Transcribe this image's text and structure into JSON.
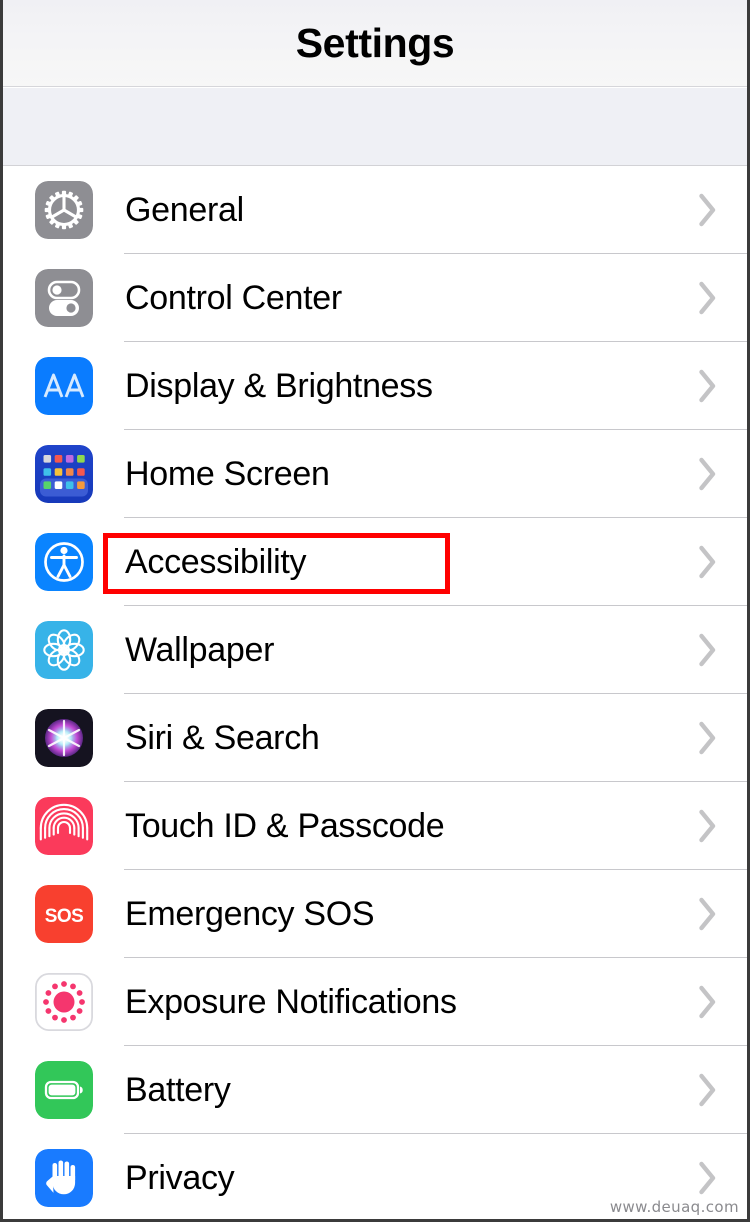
{
  "header": {
    "title": "Settings"
  },
  "watermark": "www.deuaq.com",
  "colors": {
    "accent_blue": "#0a84ff",
    "gray_icon": "#8e8e93",
    "highlight_red": "#ff0000",
    "chevron": "#c4c4c6",
    "separator": "#c8c8cc",
    "row_background": "#ffffff",
    "band_background": "#eff0f5"
  },
  "list": {
    "items": [
      {
        "label": "General",
        "icon": "gear-icon",
        "icon_color": "#8e8e93",
        "chevron": "chevron-right-icon",
        "highlighted": false
      },
      {
        "label": "Control Center",
        "icon": "toggles-icon",
        "icon_color": "#8e8e93",
        "chevron": "chevron-right-icon",
        "highlighted": false
      },
      {
        "label": "Display & Brightness",
        "icon": "display-brightness-aa-icon",
        "icon_color": "#0a7cff",
        "chevron": "chevron-right-icon",
        "highlighted": false
      },
      {
        "label": "Home Screen",
        "icon": "home-screen-grid-icon",
        "icon_color": "#1a3fc4",
        "chevron": "chevron-right-icon",
        "highlighted": false
      },
      {
        "label": "Accessibility",
        "icon": "accessibility-person-icon",
        "icon_color": "#0a84ff",
        "chevron": "chevron-right-icon",
        "highlighted": true
      },
      {
        "label": "Wallpaper",
        "icon": "wallpaper-flower-icon",
        "icon_color": "#37b3e8",
        "chevron": "chevron-right-icon",
        "highlighted": false
      },
      {
        "label": "Siri & Search",
        "icon": "siri-orb-icon",
        "icon_color": "#151320",
        "chevron": "chevron-right-icon",
        "highlighted": false
      },
      {
        "label": "Touch ID & Passcode",
        "icon": "fingerprint-icon",
        "icon_color": "#fb3a5b",
        "chevron": "chevron-right-icon",
        "highlighted": false
      },
      {
        "label": "Emergency SOS",
        "icon": "sos-icon",
        "icon_color": "#f8402f",
        "chevron": "chevron-right-icon",
        "highlighted": false
      },
      {
        "label": "Exposure Notifications",
        "icon": "exposure-notifications-icon",
        "icon_color": "#ffffff",
        "chevron": "chevron-right-icon",
        "highlighted": false
      },
      {
        "label": "Battery",
        "icon": "battery-icon",
        "icon_color": "#32c759",
        "chevron": "chevron-right-icon",
        "highlighted": false
      },
      {
        "label": "Privacy",
        "icon": "privacy-hand-icon",
        "icon_color": "#197bff",
        "chevron": "chevron-right-icon",
        "highlighted": false
      }
    ]
  }
}
